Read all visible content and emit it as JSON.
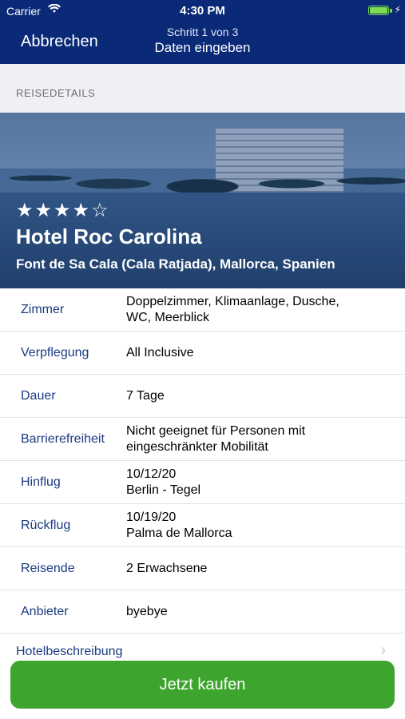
{
  "status_bar": {
    "carrier": "Carrier",
    "time": "4:30 PM"
  },
  "nav": {
    "cancel": "Abbrechen",
    "step": "Schritt 1 von 3",
    "title": "Daten eingeben"
  },
  "section_header": "REISEDETAILS",
  "hotel": {
    "stars": "★★★★☆",
    "name": "Hotel Roc Carolina",
    "location": "Font de Sa Cala (Cala Ratjada), Mallorca, Spanien"
  },
  "details": [
    {
      "label": "Zimmer",
      "lines": [
        "Doppelzimmer, Klimaanlage, Dusche,",
        "WC, Meerblick"
      ]
    },
    {
      "label": "Verpflegung",
      "lines": [
        "All Inclusive"
      ]
    },
    {
      "label": "Dauer",
      "lines": [
        "7 Tage"
      ]
    },
    {
      "label": "Barrierefreiheit",
      "lines": [
        "Nicht geeignet für Personen mit",
        "eingeschränkter Mobilität"
      ]
    },
    {
      "label": "Hinflug",
      "lines": [
        "10/12/20",
        "Berlin - Tegel"
      ]
    },
    {
      "label": "Rückflug",
      "lines": [
        "10/19/20",
        "Palma de Mallorca"
      ]
    },
    {
      "label": "Reisende",
      "lines": [
        "2 Erwachsene"
      ]
    },
    {
      "label": "Anbieter",
      "lines": [
        "byebye"
      ]
    }
  ],
  "description_link": "Hotelbeschreibung",
  "buy_button": "Jetzt kaufen",
  "colors": {
    "nav_bg": "#0a2a78",
    "label": "#1a3a82",
    "buy": "#3da52e"
  }
}
